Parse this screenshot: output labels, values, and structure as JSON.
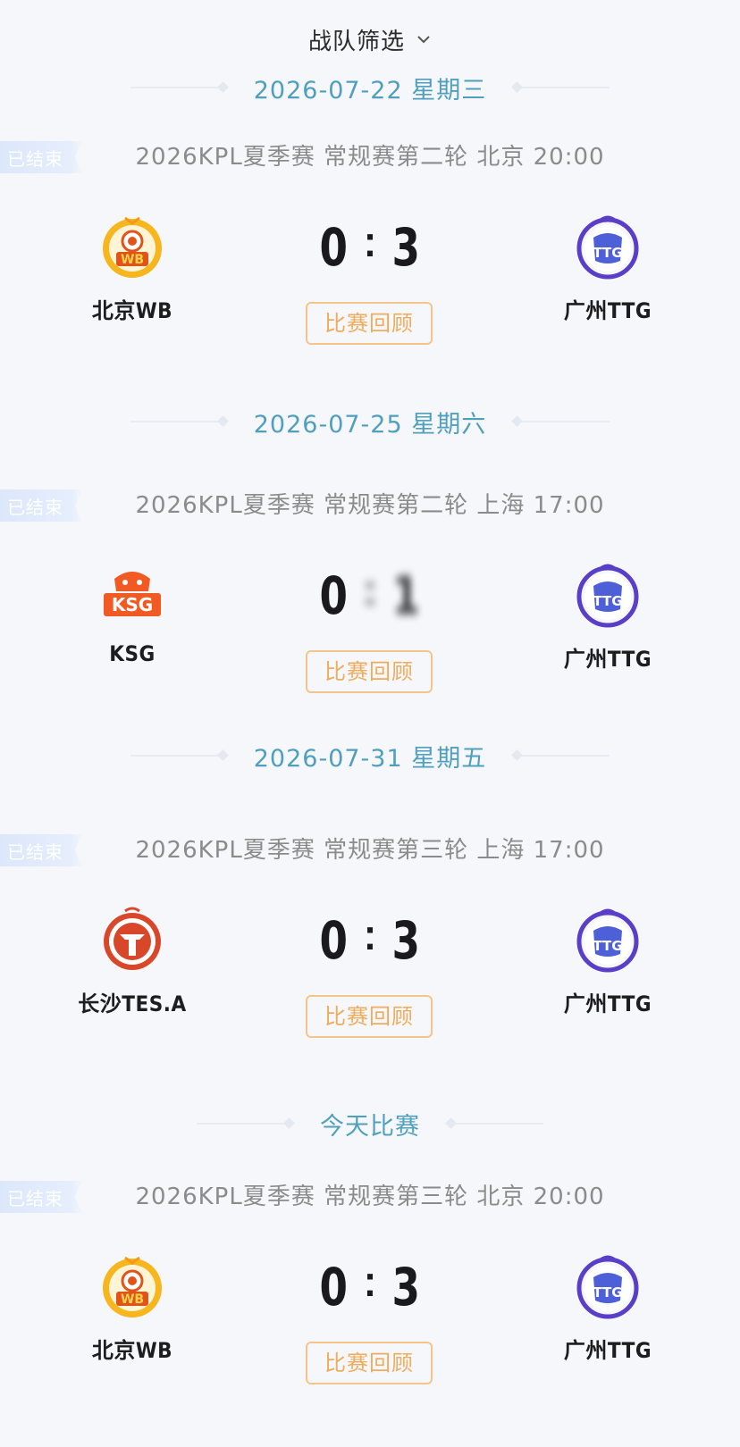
{
  "filter": {
    "label": "战队筛选"
  },
  "sections": [
    {
      "date": "2026-07-22 星期三",
      "match": {
        "status": "已结束",
        "meta": "2026KPL夏季赛 常规赛第二轮 北京 20:00",
        "home": {
          "name": "北京WB",
          "logo": "wb-logo"
        },
        "away": {
          "name": "广州TTG",
          "logo": "ttg-logo"
        },
        "score_home": "0",
        "score_away": "3",
        "review_label": "比赛回顾"
      }
    },
    {
      "date": "2026-07-25 星期六",
      "match": {
        "status": "已结束",
        "meta": "2026KPL夏季赛 常规赛第二轮 上海 17:00",
        "home": {
          "name": "KSG",
          "logo": "ksg-logo"
        },
        "away": {
          "name": "广州TTG",
          "logo": "ttg-logo"
        },
        "score_home": "0",
        "score_away": "1",
        "review_label": "比赛回顾"
      }
    },
    {
      "date": "2026-07-31 星期五",
      "match": {
        "status": "已结束",
        "meta": "2026KPL夏季赛 常规赛第三轮 上海 17:00",
        "home": {
          "name": "长沙TES.A",
          "logo": "tes-logo"
        },
        "away": {
          "name": "广州TTG",
          "logo": "ttg-logo"
        },
        "score_home": "0",
        "score_away": "3",
        "review_label": "比赛回顾"
      }
    },
    {
      "date": "今天比赛",
      "match": {
        "status": "已结束",
        "meta": "2026KPL夏季赛 常规赛第三轮 北京 20:00",
        "home": {
          "name": "北京WB",
          "logo": "wb-logo"
        },
        "away": {
          "name": "广州TTG",
          "logo": "ttg-logo"
        },
        "score_home": "0",
        "score_away": "3",
        "review_label": "比赛回顾"
      }
    }
  ]
}
